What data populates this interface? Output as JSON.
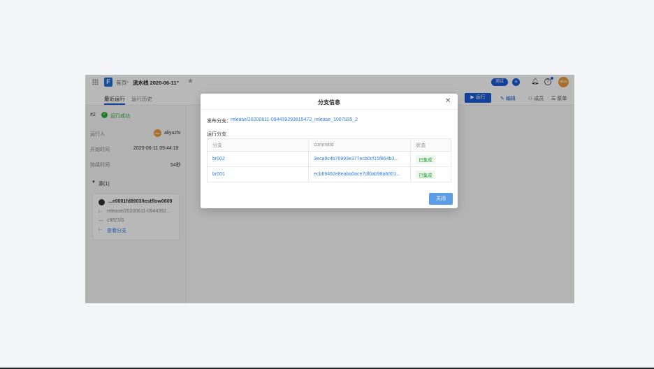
{
  "topbar": {
    "home": "首页",
    "separator": ">",
    "pipeline": "流水线 2020-06-11",
    "caret": "▾",
    "badge": "测试",
    "avatar": "aliyu"
  },
  "tabs": {
    "recent": "最近运行",
    "history": "运行历史",
    "run": "运行",
    "edit": "编辑",
    "members": "成员",
    "menu": "菜单"
  },
  "sidebar": {
    "run_number": "#2",
    "run_status": "运行成功",
    "runner_label": "运行人",
    "runner_name": "aliyuzhi",
    "runner_avatar": "aliyu",
    "start_label": "开始时间",
    "start_value": "2020-06-11 09:44:19",
    "duration_label": "持续时间",
    "duration_value": "54秒",
    "sources_header": "源(1)",
    "source": {
      "repo": "...e0001fd8903/testflow0609",
      "branch": "release/20200611-0944392...",
      "commit": "c9821f1",
      "view_branches": "查看分支"
    }
  },
  "modal": {
    "title": "分支信息",
    "release_label": "发布分支：",
    "release_branch": "release/20200611-094439293815472_release_1007935_2",
    "branches_label": "运行分支",
    "columns": [
      "分支",
      "commitId",
      "状态"
    ],
    "rows": [
      {
        "branch": "br002",
        "commit": "3eca9c4b76993e377ecb0cf15f864b3...",
        "status": "已集成"
      },
      {
        "branch": "br001",
        "commit": "ecb69462e8eaba0ace7df0ab98a6001...",
        "status": "已集成"
      }
    ],
    "close_button": "关闭"
  },
  "colors": {
    "accent": "#1a5bd8",
    "link": "#2e7be6",
    "success": "#2dab3f"
  }
}
